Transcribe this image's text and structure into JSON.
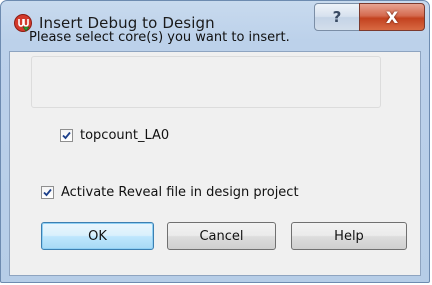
{
  "window": {
    "title": "Insert Debug to Design",
    "help_glyph": "?",
    "close_glyph": "X",
    "app_icon": "debug-insert-icon"
  },
  "dialog": {
    "prompt": "Please select core(s) you want to insert.",
    "cores": [
      {
        "label": "topcount_LA0",
        "checked": true
      }
    ],
    "activate_option": {
      "label": "Activate Reveal file in design project",
      "checked": true
    }
  },
  "buttons": {
    "ok": "OK",
    "cancel": "Cancel",
    "help": "Help"
  },
  "colors": {
    "title_bar": "#bcd1ea",
    "close_button": "#c3421f",
    "ok_border": "#3c7fb1"
  }
}
